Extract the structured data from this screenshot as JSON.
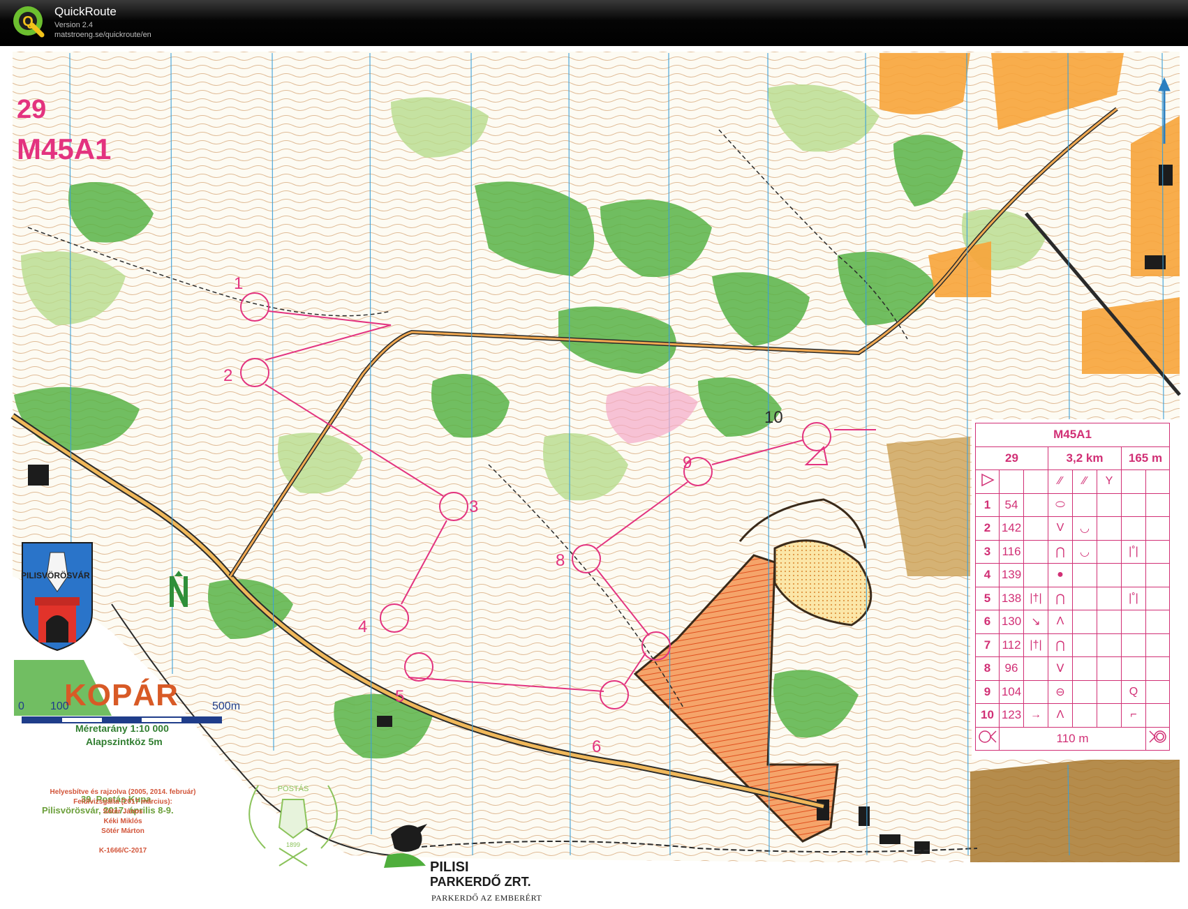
{
  "app": {
    "logo_letter": "Q",
    "title": "QuickRoute",
    "version": "Version 2.4",
    "url": "matstroeng.se/quickroute/en"
  },
  "map": {
    "course_number": "29",
    "course_name": "M45A1",
    "town_name": "PILISVÖRÖSVÁR",
    "title": "KOPÁR",
    "scale": "Méretarány 1:10 000",
    "contour_interval": "Alapszintköz 5m",
    "scale_bar_labels": [
      "0",
      "100",
      "500m"
    ],
    "event_line1": "39. Postás Kupa",
    "event_line2": "Pilisvörösvár, 2017. április 8-9.",
    "credits": [
      "Helyesbítve és rajzolva (2005, 2014. február)",
      "Felülvizsgálta (2017 március):",
      "Sötér János",
      "Kéki Miklós",
      "Sötér Márton"
    ],
    "permit": "K-1666/C-2017",
    "postas_logo_text": "POSTÁS",
    "postas_logo_year": "1899",
    "forestry_name_line1": "PILISI",
    "forestry_name_line2": "PARKERDŐ ZRT.",
    "forestry_slogan": "PARKERDŐ AZ EMBERÉRT",
    "control_labels": [
      "1",
      "2",
      "3",
      "4",
      "5",
      "6",
      "8",
      "9",
      "10"
    ],
    "colors": {
      "course_magenta": "#e3337f",
      "forest_green": "#4fae3c",
      "open_yellow": "#f7a43a",
      "contour_brown": "#c17a3a",
      "north_line_blue": "#3a9fd8"
    }
  },
  "description_sheet": {
    "title": "M45A1",
    "course": "29",
    "length": "3,2 km",
    "climb": "165 m",
    "controls": [
      {
        "num": "1",
        "code": "54",
        "col_d": "",
        "col_e": "⬭",
        "col_f": "",
        "col_g": "",
        "col_h": ""
      },
      {
        "num": "2",
        "code": "142",
        "col_d": "",
        "col_e": "V",
        "col_f": "◡",
        "col_g": "",
        "col_h": ""
      },
      {
        "num": "3",
        "code": "116",
        "col_d": "",
        "col_e": "⋂",
        "col_f": "◡",
        "col_g": "",
        "col_h": "|˚|"
      },
      {
        "num": "4",
        "code": "139",
        "col_d": "",
        "col_e": "●",
        "col_f": "",
        "col_g": "",
        "col_h": ""
      },
      {
        "num": "5",
        "code": "138",
        "col_d": "|†|",
        "col_e": "⋂",
        "col_f": "",
        "col_g": "",
        "col_h": "|˚|"
      },
      {
        "num": "6",
        "code": "130",
        "col_d": "↘",
        "col_e": "Λ",
        "col_f": "",
        "col_g": "",
        "col_h": ""
      },
      {
        "num": "7",
        "code": "112",
        "col_d": "|†|",
        "col_e": "⋂",
        "col_f": "",
        "col_g": "",
        "col_h": ""
      },
      {
        "num": "8",
        "code": "96",
        "col_d": "",
        "col_e": "ᐯ",
        "col_f": "",
        "col_g": "",
        "col_h": ""
      },
      {
        "num": "9",
        "code": "104",
        "col_d": "",
        "col_e": "⊖",
        "col_f": "",
        "col_g": "",
        "col_h": "Q"
      },
      {
        "num": "10",
        "code": "123",
        "col_d": "→",
        "col_e": "Λ",
        "col_f": "",
        "col_g": "",
        "col_h": "⌐"
      }
    ],
    "finish_distance": "110 m"
  }
}
